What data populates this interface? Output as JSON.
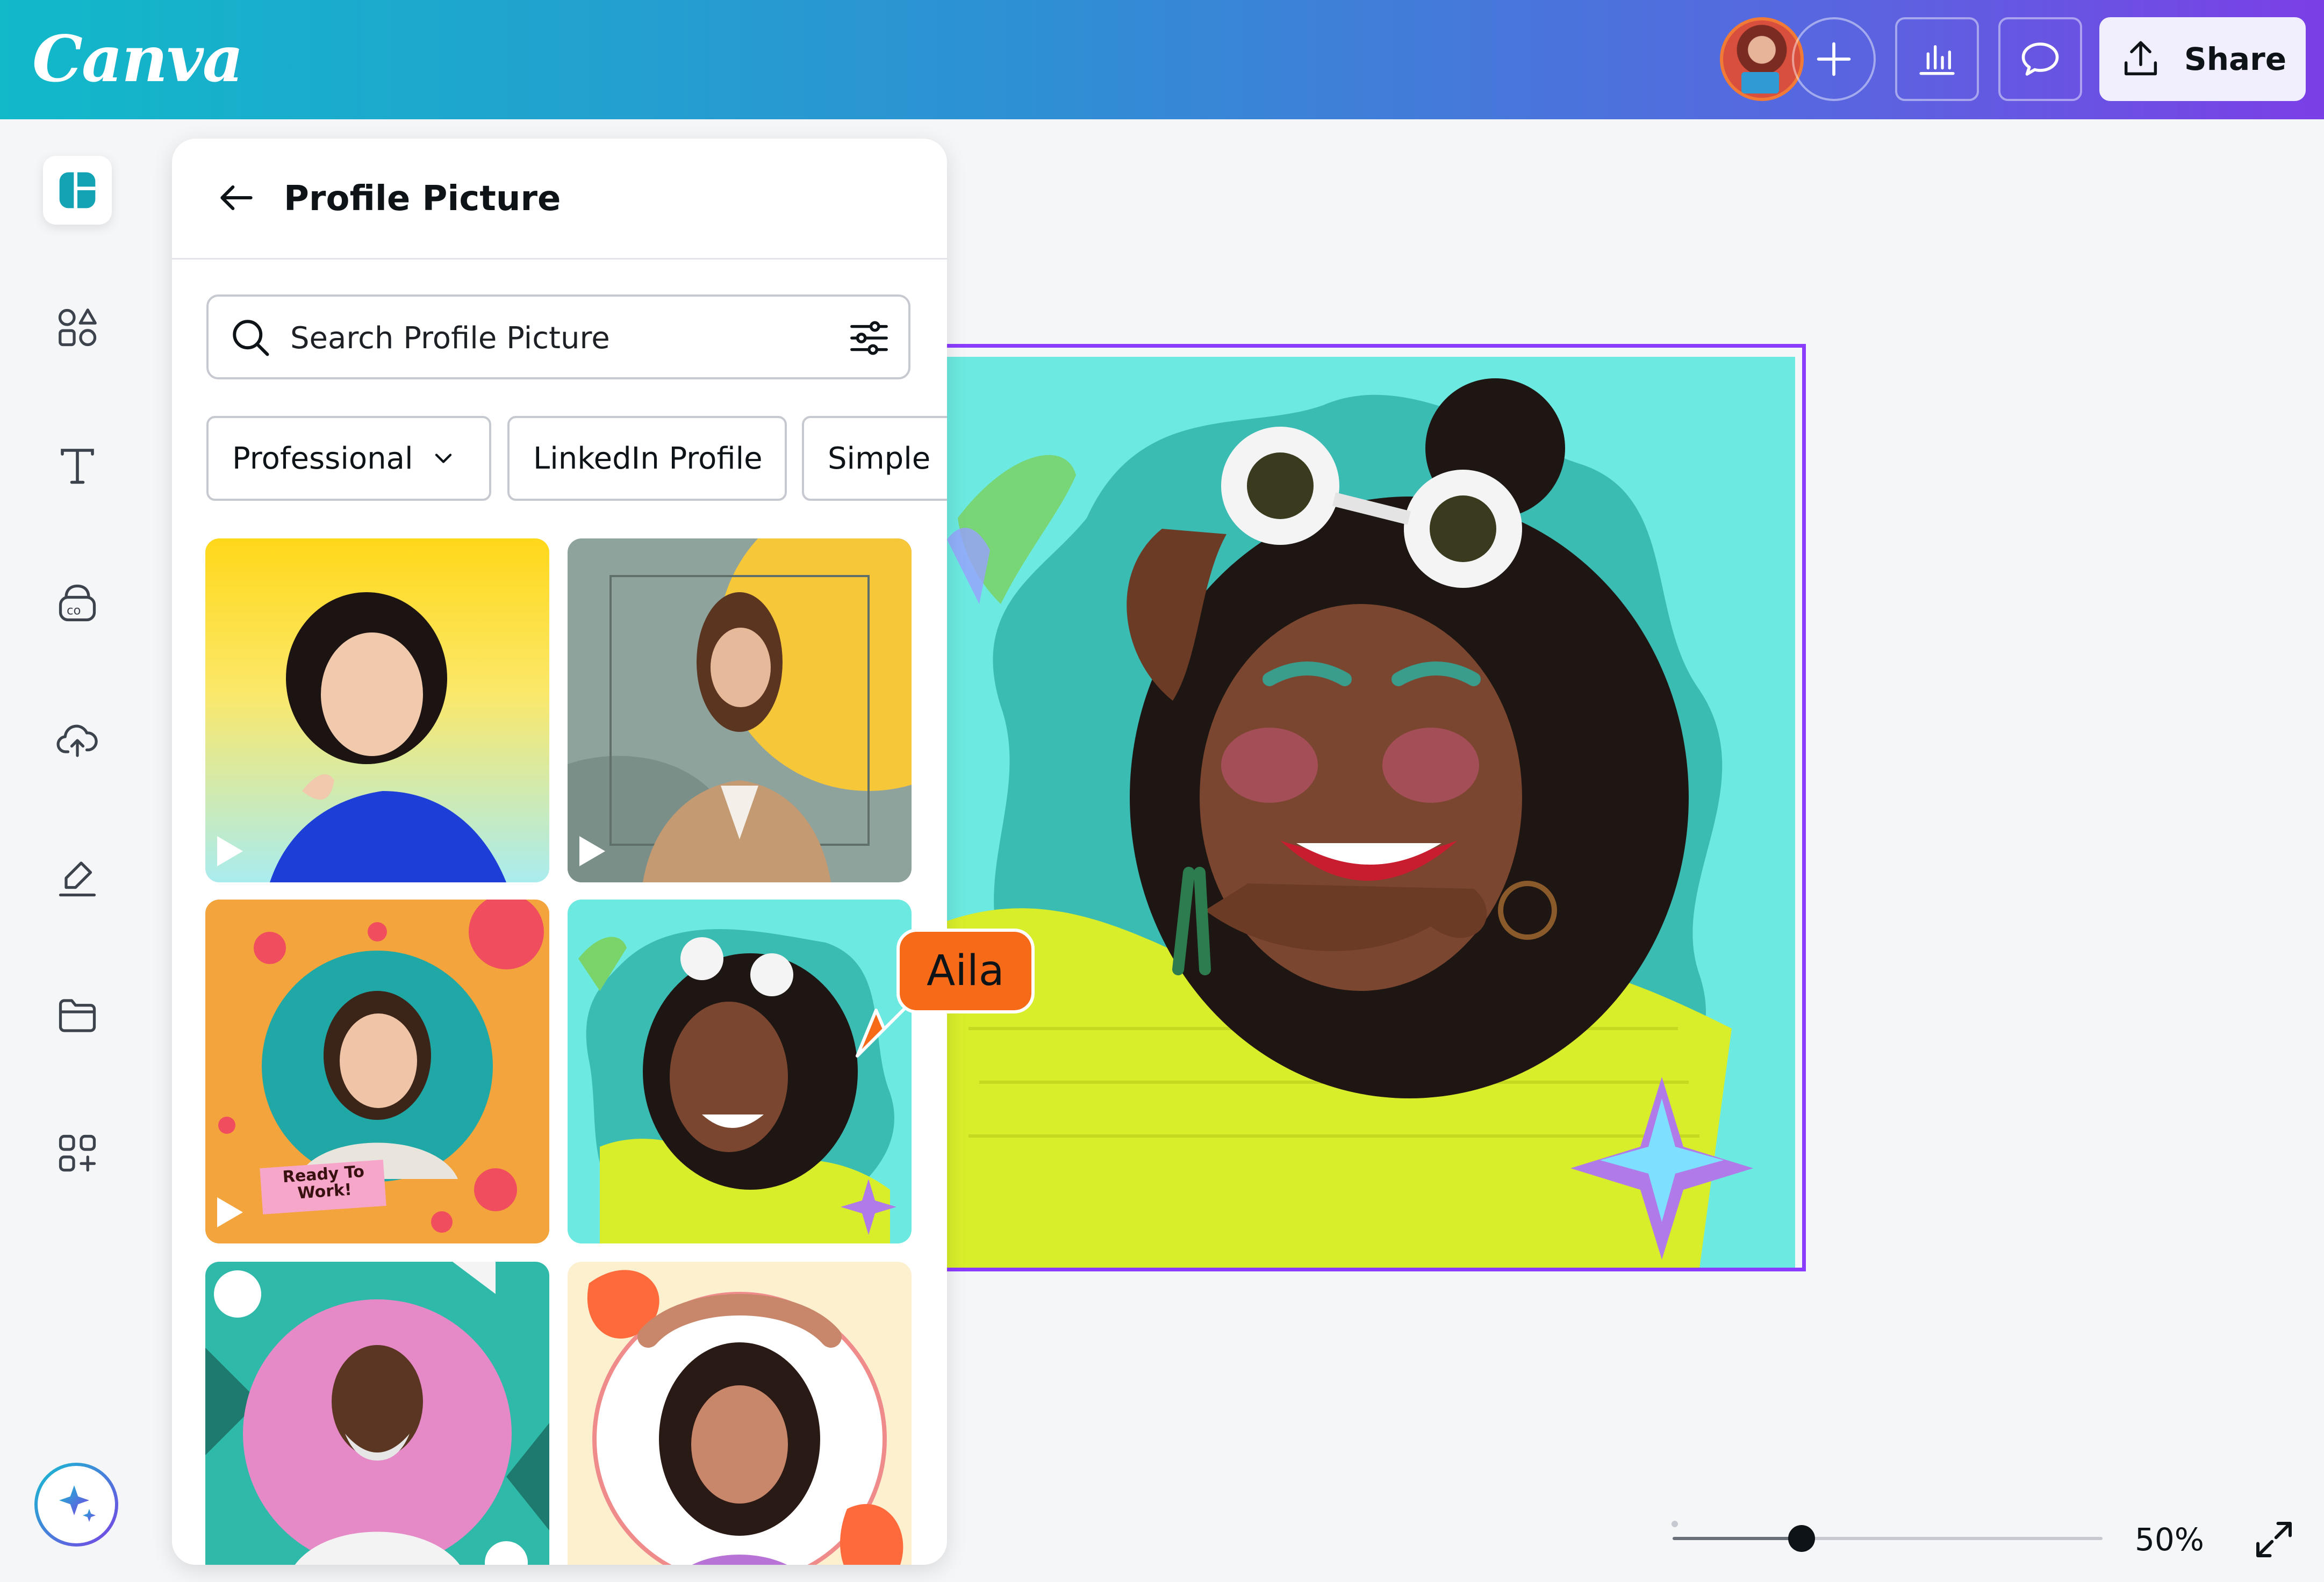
{
  "app": {
    "logo": "Canva"
  },
  "header": {
    "add_collaborator_icon": "plus-icon",
    "insights_icon": "bar-chart-icon",
    "comments_icon": "speech-bubble-icon",
    "share": {
      "label": "Share",
      "icon": "upload-icon"
    }
  },
  "rail": {
    "items": [
      {
        "name": "design",
        "icon": "layout-icon"
      },
      {
        "name": "elements",
        "icon": "shapes-icon"
      },
      {
        "name": "text",
        "icon": "text-icon"
      },
      {
        "name": "brand",
        "icon": "brand-kit-icon"
      },
      {
        "name": "uploads",
        "icon": "cloud-upload-icon"
      },
      {
        "name": "draw",
        "icon": "draw-icon"
      },
      {
        "name": "projects",
        "icon": "folder-icon"
      },
      {
        "name": "apps",
        "icon": "apps-icon"
      }
    ],
    "magic_icon": "sparkle-icon"
  },
  "panel": {
    "title": "Profile Picture",
    "search": {
      "placeholder": "Search Profile Picture",
      "value": ""
    },
    "chips": [
      "Professional",
      "LinkedIn Profile",
      "Simple"
    ],
    "tiles": [
      {
        "name": "yellow-halftone-portrait",
        "video": true
      },
      {
        "name": "businesswoman-grey-yellow",
        "video": true
      },
      {
        "name": "ready-to-work-orange-floral",
        "video": true,
        "text": "Ready To Work!"
      },
      {
        "name": "teal-wavy-sunglasses",
        "video": false
      },
      {
        "name": "teal-geometric-man",
        "video": false
      },
      {
        "name": "cream-coral-woman",
        "video": false
      }
    ]
  },
  "collaborator": {
    "name": "Aila",
    "color": "#f76b18"
  },
  "zoom": {
    "value": "50%",
    "level": 0.3
  },
  "colors": {
    "accent": "#8b3dff",
    "page_bg": "#6ce9e0",
    "header_start": "#11b9c9",
    "header_end": "#7b3fe6"
  }
}
